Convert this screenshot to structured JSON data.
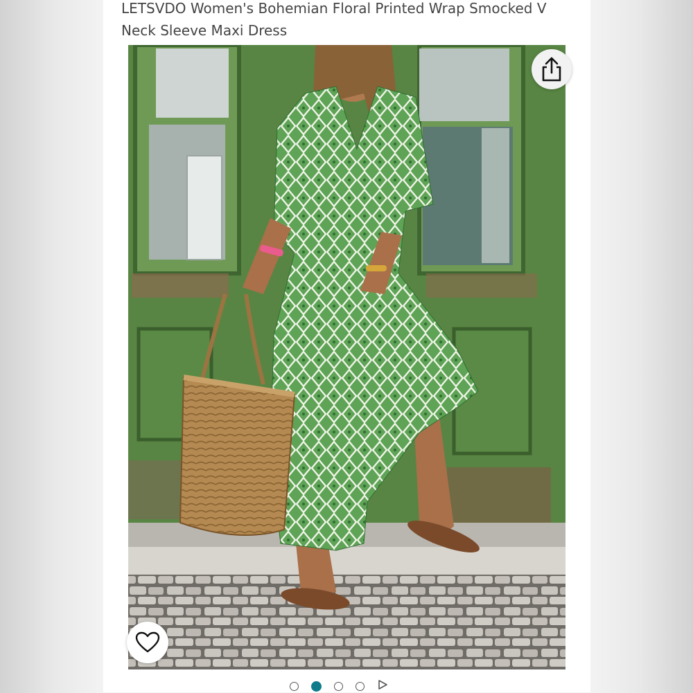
{
  "product": {
    "title": "LETSVDO Women's Bohemian Floral Printed Wrap Smocked V Neck Sleeve Maxi Dress"
  },
  "gallery": {
    "image_icon": "product-photo",
    "share_icon": "share-icon",
    "favorite_icon": "heart-icon",
    "dots_total": 4,
    "active_dot": 2,
    "has_video": true,
    "accent_color": "#0f7c8c"
  }
}
